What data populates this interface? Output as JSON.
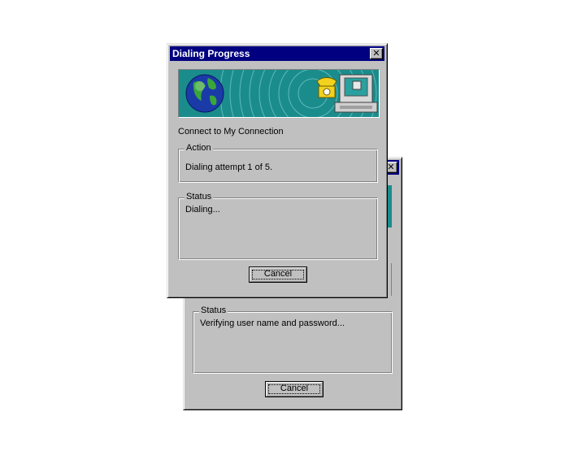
{
  "back_dialog": {
    "close_glyph": "✕",
    "status": {
      "legend": "Status",
      "text": "Verifying user name and password..."
    },
    "cancel_label": "Cancel"
  },
  "front_dialog": {
    "title": "Dialing Progress",
    "close_glyph": "✕",
    "banner_icons": [
      "globe-icon",
      "computer-phone-icon"
    ],
    "connect_label": "Connect to My Connection",
    "action": {
      "legend": "Action",
      "text": "Dialing attempt 1 of 5."
    },
    "status": {
      "legend": "Status",
      "text": "Dialing..."
    },
    "cancel_label": "Cancel"
  },
  "colors": {
    "title_bar": "#000080",
    "dialog_face": "#c0c0c0",
    "banner_teal": "#1b8c8c"
  }
}
